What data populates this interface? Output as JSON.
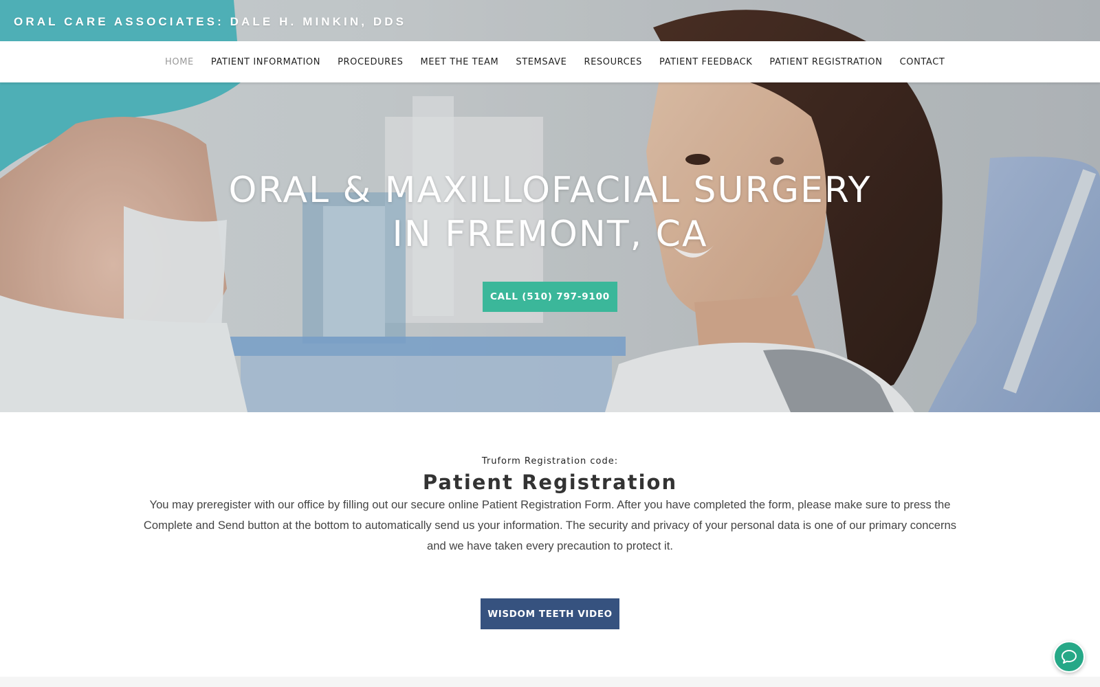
{
  "site": {
    "title": "ORAL CARE ASSOCIATES: DALE H. MINKIN, DDS"
  },
  "nav": {
    "items": [
      {
        "label": "HOME",
        "active": true
      },
      {
        "label": "PATIENT INFORMATION",
        "active": false
      },
      {
        "label": "PROCEDURES",
        "active": false
      },
      {
        "label": "MEET THE TEAM",
        "active": false
      },
      {
        "label": "STEMSAVE",
        "active": false
      },
      {
        "label": "RESOURCES",
        "active": false
      },
      {
        "label": "PATIENT FEEDBACK",
        "active": false
      },
      {
        "label": "PATIENT REGISTRATION",
        "active": false
      },
      {
        "label": "CONTACT",
        "active": false
      }
    ]
  },
  "hero": {
    "heading_line1": "ORAL & MAXILLOFACIAL SURGERY",
    "heading_line2": "IN FREMONT, CA",
    "call_button": "CALL (510) 797-9100"
  },
  "registration": {
    "truform_label": "Truform Registration code:",
    "title": "Patient Registration",
    "body": "You may preregister with our office by filling out our secure online Patient Registration Form. After you have completed the form, please make sure to press the Complete and Send button at the bottom to automatically send us your information. The security and privacy of your personal data is one of our primary concerns and we have taken every precaution to protect it.",
    "video_button": "WISDOM TEETH VIDEO"
  },
  "chat_widget": {
    "icon": "chat-bubble-icon"
  },
  "colors": {
    "accent_teal": "#3bb79a",
    "accent_navy": "#36527f",
    "nav_active": "#999999",
    "nav_text": "#222222"
  }
}
